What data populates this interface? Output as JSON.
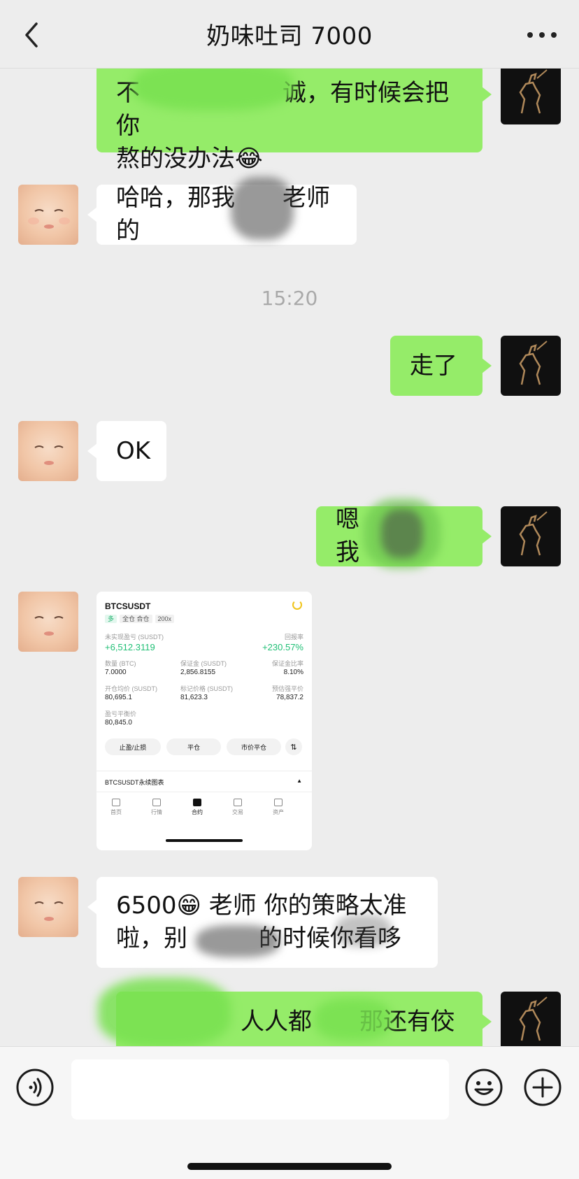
{
  "header": {
    "title": "奶味吐司 7000"
  },
  "messages": {
    "m1_line1": "不　　　　　　诚，有时候会把你",
    "m1_line2": "熬的没办法😂",
    "m2": "哈哈，那我　　老师的",
    "time": "15:20",
    "m3": "走了",
    "m4": "OK",
    "m5": "嗯　　　　我",
    "m7_line1": "6500😁 老师 你的策略太准",
    "m7_line2": "啦，别　　　的时候你看哆",
    "m8": "人人都　　那还有佼"
  },
  "screenshot_card": {
    "symbol": "BTCSUSDT",
    "tag_long": "多",
    "tag_mode": "全仓 合仓",
    "tag_leverage": "200x",
    "unrealized_label": "未实现盈亏 (SUSDT)",
    "unrealized_value": "+6,512.3119",
    "roe_label": "回报率",
    "roe_value": "+230.57%",
    "qty_label": "数量 (BTC)",
    "qty_value": "7.0000",
    "margin_label": "保证金 (SUSDT)",
    "margin_value": "2,856.8155",
    "margin_ratio_label": "保证金比率",
    "margin_ratio_value": "8.10%",
    "entry_label": "开仓均价 (SUSDT)",
    "entry_value": "80,695.1",
    "mark_label": "标记价格 (SUSDT)",
    "mark_value": "81,623.3",
    "liq_label": "预估强平价",
    "liq_value": "78,837.2",
    "breakeven_label": "盈亏平衡价",
    "breakeven_value": "80,845.0",
    "btn_tpsl": "止盈/止损",
    "btn_close": "平仓",
    "btn_market_close": "市价平仓",
    "chart_label": "BTCSUSDT永续图表",
    "tabs": [
      "首页",
      "行情",
      "合约",
      "交易",
      "资产"
    ]
  },
  "composer": {
    "input_value": ""
  }
}
